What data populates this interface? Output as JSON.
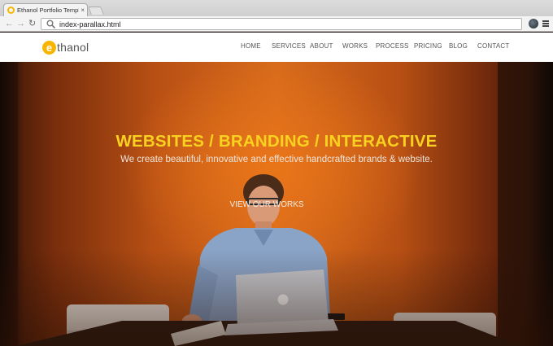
{
  "browser": {
    "tab_title": "Ethanol Portfolio Templat",
    "tab_close": "×",
    "url": "index-parallax.html",
    "nav_icons": {
      "back": "back-arrow-icon",
      "forward": "forward-arrow-icon",
      "reload": "reload-icon"
    }
  },
  "site": {
    "logo_letter": "e",
    "logo_text": "thanol",
    "nav": [
      {
        "label": "HOME"
      },
      {
        "label": "SERVICES"
      },
      {
        "label": "ABOUT"
      },
      {
        "label": "WORKS"
      },
      {
        "label": "PROCESS"
      },
      {
        "label": "PRICING"
      },
      {
        "label": "BLOG"
      },
      {
        "label": "CONTACT"
      }
    ]
  },
  "hero": {
    "title": "WEBSITES / BRANDING / INTERACTIVE",
    "subtitle": "We create beautiful, innovative and effective handcrafted brands & website.",
    "cta": "VIEW OUR WORKS"
  },
  "colors": {
    "accent_yellow": "#f9d21f",
    "logo_orange": "#f7b500",
    "hero_orange": "#d66a1c"
  }
}
